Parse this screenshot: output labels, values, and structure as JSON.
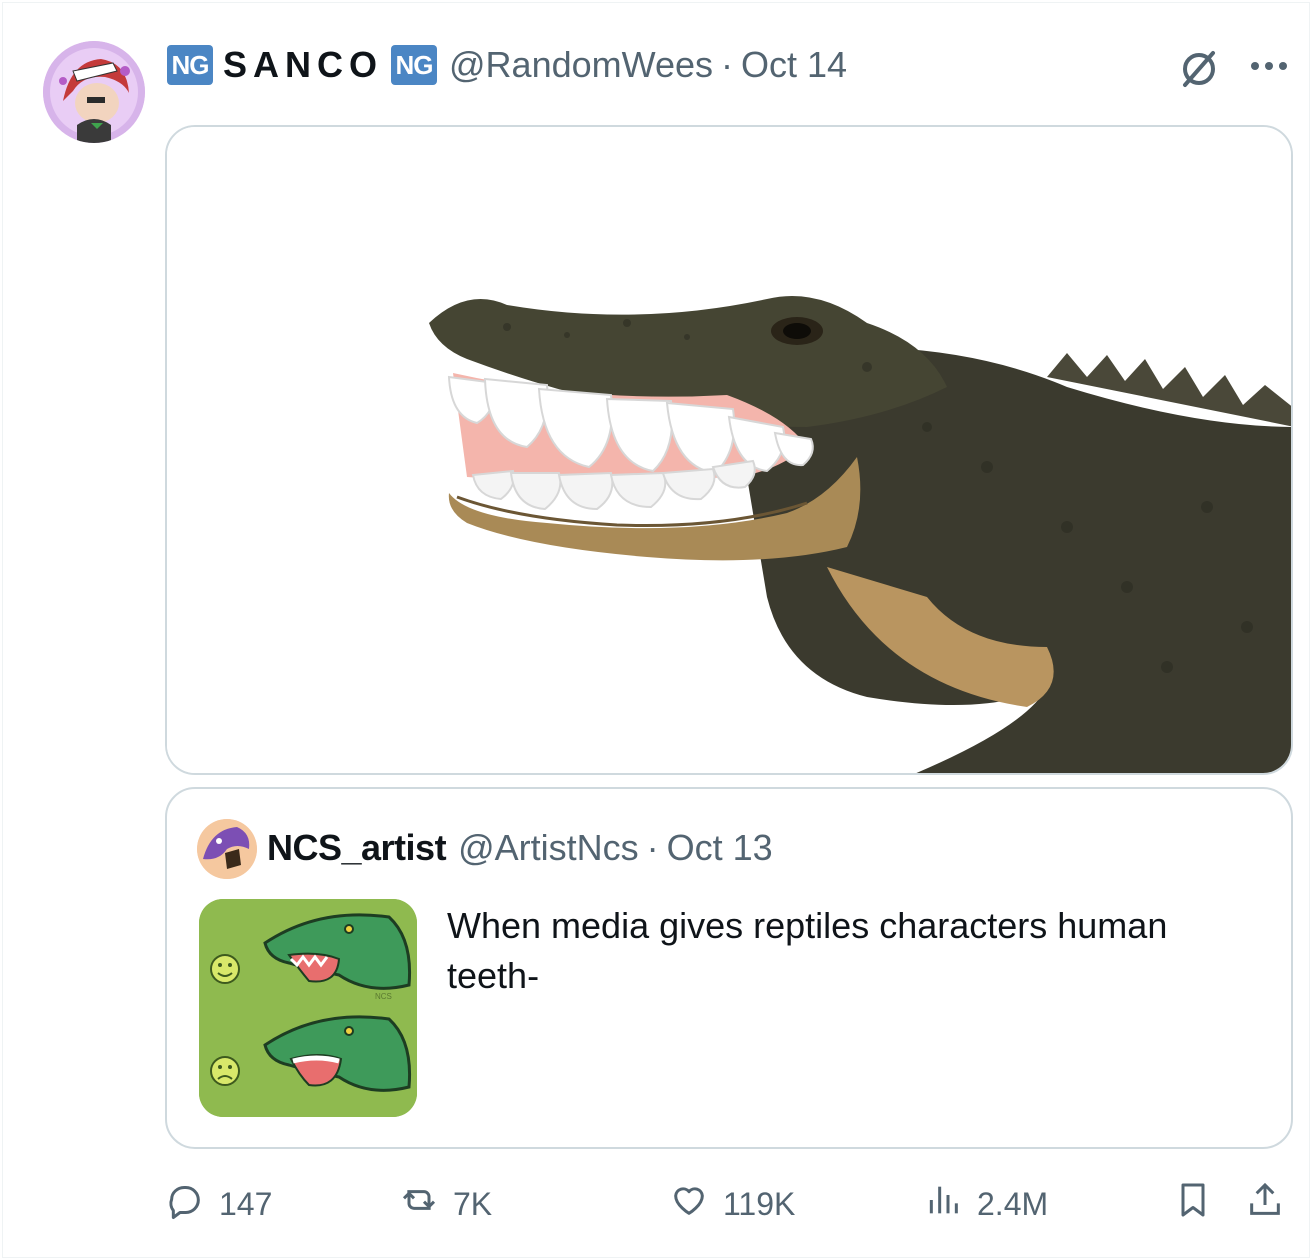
{
  "tweet": {
    "badge_left": "NG",
    "display_name": "SANCO",
    "badge_right": "NG",
    "handle": "@RandomWees",
    "separator": "·",
    "date": "Oct 14"
  },
  "quote": {
    "name": "NCS_artist",
    "handle": "@ArtistNcs",
    "separator": "·",
    "date": "Oct 13",
    "text": "When media gives reptiles characters human teeth-",
    "thumb_signature": "NCS"
  },
  "actions": {
    "replies": "147",
    "retweets": "7K",
    "likes": "119K",
    "views": "2.4M"
  },
  "icons": {
    "header_right": [
      "grok-icon",
      "more-icon"
    ],
    "action_bar": [
      "reply-icon",
      "retweet-icon",
      "like-icon",
      "views-icon",
      "bookmark-icon",
      "share-icon"
    ]
  },
  "colors": {
    "text_primary": "#0f1419",
    "text_secondary": "#536471",
    "border": "#cfd9de",
    "badge_blue": "#4b86c4",
    "thumb_green": "#8fba4f"
  }
}
